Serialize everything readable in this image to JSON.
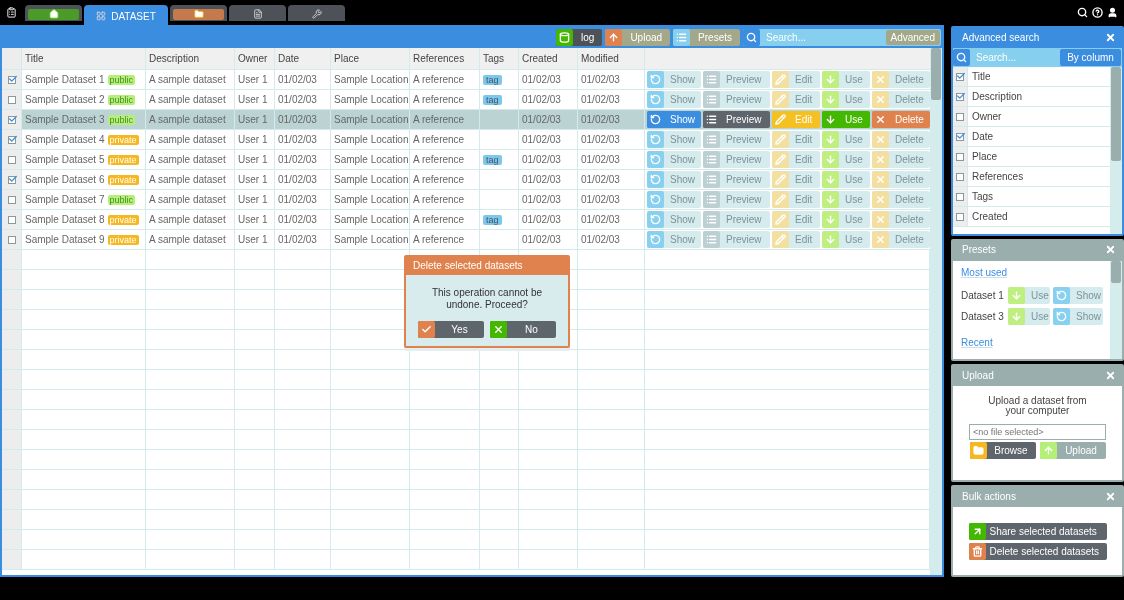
{
  "tabs": [
    {
      "kind": "home",
      "selected": false
    },
    {
      "kind": "dataset",
      "label": "DATASET",
      "selected": true
    },
    {
      "kind": "folder",
      "selected": false
    },
    {
      "kind": "document",
      "selected": false
    },
    {
      "kind": "tools",
      "selected": false
    }
  ],
  "toolbar": {
    "buttons": [
      {
        "kind": "log",
        "label": "log",
        "pressed": true
      },
      {
        "kind": "upload",
        "label": "Upload",
        "pressed": false
      },
      {
        "kind": "presets",
        "label": "Presets",
        "pressed": false
      }
    ],
    "search": {
      "placeholder": "Search...",
      "button": "Advanced"
    }
  },
  "table": {
    "columns": [
      "Title",
      "Description",
      "Owner",
      "Date",
      "Place",
      "References",
      "Tags",
      "Created",
      "Modified"
    ],
    "rows": [
      {
        "checked": true,
        "selected": false,
        "title": "Sample Dataset 1",
        "badge": {
          "label": "public",
          "kind": "public"
        },
        "description": "A sample dataset",
        "owner": "User 1",
        "date": "01/02/03",
        "place": "Sample Location",
        "reference": "A reference",
        "tag": "tag",
        "created": "01/02/03",
        "modified": "01/02/03",
        "actions": [
          {
            "kind": "show",
            "label": "Show"
          },
          {
            "kind": "preview",
            "label": "Preview"
          },
          {
            "kind": "edit",
            "label": "Edit"
          },
          {
            "kind": "use",
            "label": "Use"
          },
          {
            "kind": "delete",
            "label": "Delete"
          }
        ]
      },
      {
        "checked": false,
        "selected": false,
        "title": "Sample Dataset 2",
        "badge": {
          "label": "public",
          "kind": "public"
        },
        "description": "A sample dataset",
        "owner": "User 1",
        "date": "01/02/03",
        "place": "Sample Location",
        "reference": "A reference",
        "tag": "tag",
        "created": "01/02/03",
        "modified": "01/02/03",
        "actions": [
          {
            "kind": "show",
            "label": "Show"
          },
          {
            "kind": "preview",
            "label": "Preview"
          },
          {
            "kind": "edit",
            "label": "Edit"
          },
          {
            "kind": "use",
            "label": "Use"
          },
          {
            "kind": "delete",
            "label": "Delete"
          }
        ]
      },
      {
        "checked": true,
        "selected": true,
        "title": "Sample Dataset 3",
        "badge": {
          "label": "public",
          "kind": "public"
        },
        "description": "A sample dataset",
        "owner": "User 1",
        "date": "01/02/03",
        "place": "Sample Location",
        "reference": "A reference",
        "created": "01/02/03",
        "modified": "01/02/03",
        "actions": [
          {
            "kind": "show",
            "label": "Show"
          },
          {
            "kind": "preview",
            "label": "Preview"
          },
          {
            "kind": "edit",
            "label": "Edit"
          },
          {
            "kind": "use",
            "label": "Use"
          },
          {
            "kind": "delete",
            "label": "Delete"
          }
        ]
      },
      {
        "checked": true,
        "selected": false,
        "title": "Sample Dataset 4",
        "badge": {
          "label": "private",
          "kind": "private"
        },
        "description": "A sample dataset",
        "owner": "User 1",
        "date": "01/02/03",
        "place": "Sample Location",
        "reference": "A reference",
        "created": "01/02/03",
        "modified": "01/02/03",
        "actions": [
          {
            "kind": "show",
            "label": "Show"
          },
          {
            "kind": "preview",
            "label": "Preview"
          },
          {
            "kind": "edit",
            "label": "Edit"
          },
          {
            "kind": "use",
            "label": "Use"
          },
          {
            "kind": "delete",
            "label": "Delete"
          }
        ]
      },
      {
        "checked": false,
        "selected": false,
        "title": "Sample Dataset 5",
        "badge": {
          "label": "private",
          "kind": "private"
        },
        "description": "A sample dataset",
        "owner": "User 1",
        "date": "01/02/03",
        "place": "Sample Location",
        "reference": "A reference",
        "tag": "tag",
        "created": "01/02/03",
        "modified": "01/02/03",
        "actions": [
          {
            "kind": "show",
            "label": "Show"
          },
          {
            "kind": "preview",
            "label": "Preview"
          },
          {
            "kind": "edit",
            "label": "Edit"
          },
          {
            "kind": "use",
            "label": "Use"
          },
          {
            "kind": "delete",
            "label": "Delete"
          }
        ]
      },
      {
        "checked": true,
        "selected": false,
        "title": "Sample Dataset 6",
        "badge": {
          "label": "private",
          "kind": "private"
        },
        "description": "A sample dataset",
        "owner": "User 1",
        "date": "01/02/03",
        "place": "Sample Location",
        "reference": "A reference",
        "created": "01/02/03",
        "modified": "01/02/03",
        "actions": [
          {
            "kind": "show",
            "label": "Show"
          },
          {
            "kind": "preview",
            "label": "Preview"
          },
          {
            "kind": "edit",
            "label": "Edit"
          },
          {
            "kind": "use",
            "label": "Use"
          },
          {
            "kind": "delete",
            "label": "Delete"
          }
        ]
      },
      {
        "checked": false,
        "selected": false,
        "title": "Sample Dataset 7",
        "badge": {
          "label": "public",
          "kind": "public"
        },
        "description": "A sample dataset",
        "owner": "User 1",
        "date": "01/02/03",
        "place": "Sample Location",
        "reference": "A reference",
        "created": "01/02/03",
        "modified": "01/02/03",
        "actions": [
          {
            "kind": "show",
            "label": "Show"
          },
          {
            "kind": "preview",
            "label": "Preview"
          },
          {
            "kind": "edit",
            "label": "Edit"
          },
          {
            "kind": "use",
            "label": "Use"
          },
          {
            "kind": "delete",
            "label": "Delete"
          }
        ]
      },
      {
        "checked": false,
        "selected": false,
        "title": "Sample Dataset 8",
        "badge": {
          "label": "private",
          "kind": "private"
        },
        "description": "A sample dataset",
        "owner": "User 1",
        "date": "01/02/03",
        "place": "Sample Location",
        "reference": "A reference",
        "tag": "tag",
        "created": "01/02/03",
        "modified": "01/02/03",
        "actions": [
          {
            "kind": "show",
            "label": "Show"
          },
          {
            "kind": "preview",
            "label": "Preview"
          },
          {
            "kind": "edit",
            "label": "Edit"
          },
          {
            "kind": "use",
            "label": "Use"
          },
          {
            "kind": "delete",
            "label": "Delete"
          }
        ]
      },
      {
        "checked": false,
        "selected": false,
        "title": "Sample Dataset 9",
        "badge": {
          "label": "private",
          "kind": "private"
        },
        "description": "A sample dataset",
        "owner": "User 1",
        "date": "01/02/03",
        "place": "Sample Location",
        "reference": "A reference",
        "created": "01/02/03",
        "modified": "01/02/03",
        "actions": [
          {
            "kind": "show",
            "label": "Show"
          },
          {
            "kind": "preview",
            "label": "Preview"
          },
          {
            "kind": "edit",
            "label": "Edit"
          },
          {
            "kind": "use",
            "label": "Use"
          },
          {
            "kind": "delete",
            "label": "Delete"
          }
        ]
      }
    ]
  },
  "dialog": {
    "title": "Delete selected datasets",
    "message": "This operation cannot be undone. Proceed?",
    "buttons": [
      {
        "kind": "yes",
        "label": "Yes"
      },
      {
        "kind": "no",
        "label": "No"
      }
    ]
  },
  "sidebar": {
    "advanced_search": {
      "title": "Advanced search",
      "active": true,
      "search": {
        "placeholder": "Search...",
        "button": "By column"
      },
      "columns": [
        {
          "label": "Title",
          "checked": true
        },
        {
          "label": "Description",
          "checked": true
        },
        {
          "label": "Owner",
          "checked": false
        },
        {
          "label": "Date",
          "checked": true
        },
        {
          "label": "Place",
          "checked": false
        },
        {
          "label": "References",
          "checked": false
        },
        {
          "label": "Tags",
          "checked": false
        },
        {
          "label": "Created",
          "checked": false
        }
      ]
    },
    "presets": {
      "title": "Presets",
      "active": false,
      "links": [
        "Most used",
        "Recent"
      ],
      "items": [
        {
          "name": "Dataset 1",
          "actions": [
            {
              "kind": "use",
              "label": "Use"
            },
            {
              "kind": "show",
              "label": "Show"
            }
          ]
        },
        {
          "name": "Dataset 3",
          "actions": [
            {
              "kind": "use",
              "label": "Use"
            },
            {
              "kind": "show",
              "label": "Show"
            }
          ]
        }
      ]
    },
    "upload": {
      "title": "Upload",
      "active": false,
      "text": "Upload a dataset from your computer",
      "file": {
        "placeholder": "<no file selected>"
      },
      "buttons": [
        {
          "kind": "browse",
          "label": "Browse",
          "disabled": false
        },
        {
          "kind": "upload",
          "label": "Upload",
          "disabled": true
        }
      ]
    },
    "bulk": {
      "title": "Bulk actions",
      "active": false,
      "buttons": [
        {
          "kind": "share",
          "label": "Share selected datasets"
        },
        {
          "kind": "delete",
          "label": "Delete selected datasets"
        }
      ]
    }
  }
}
